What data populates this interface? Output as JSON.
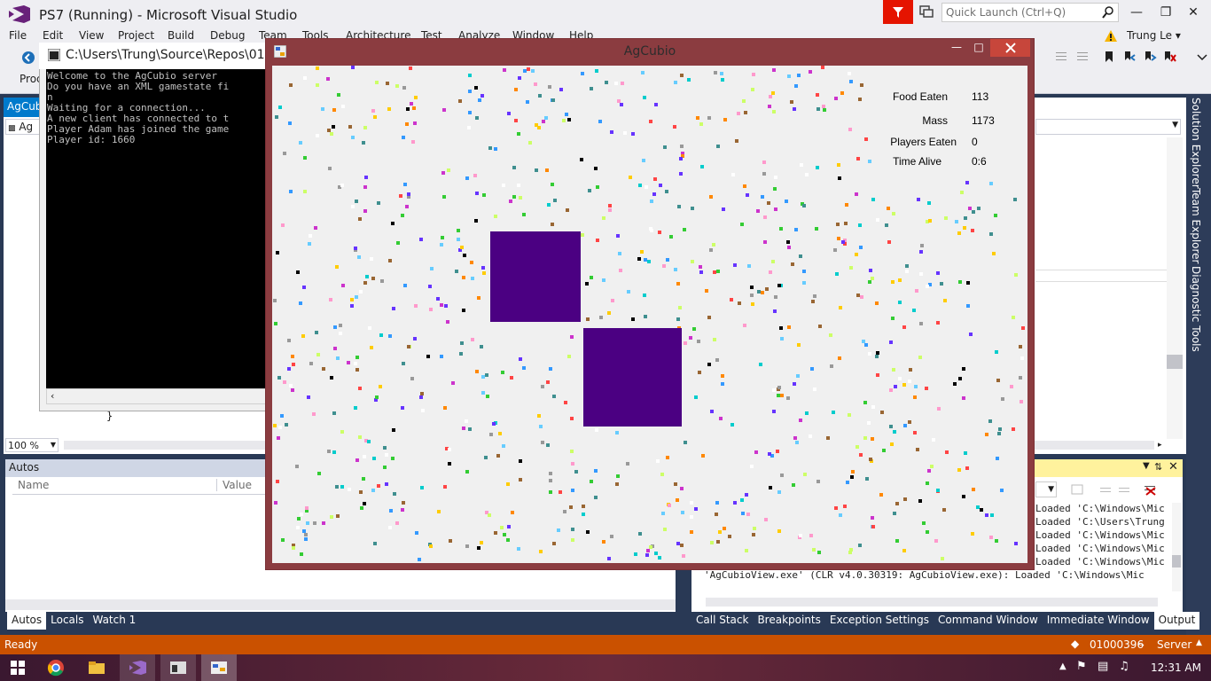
{
  "vs": {
    "title": "PS7 (Running) - Microsoft Visual Studio",
    "quick_launch_placeholder": "Quick Launch (Ctrl+Q)",
    "user": "Trung Le",
    "menu": [
      "File",
      "Edit",
      "View",
      "Project",
      "Build",
      "Debug",
      "Team",
      "Tools",
      "Architecture",
      "Test",
      "Analyze",
      "Window",
      "Help"
    ],
    "editor_tab": "AgCubi",
    "editor_combo": "Ag",
    "code_brace": "}",
    "zoom": "100 %",
    "toolbar_proc": "Proc",
    "side_tabs": [
      "Solution Explorer",
      "Team Explorer",
      "Diagnostic Tools"
    ]
  },
  "autos": {
    "title": "Autos",
    "columns": [
      "Name",
      "Value"
    ],
    "tabs": [
      "Autos",
      "Locals",
      "Watch 1"
    ]
  },
  "output": {
    "lines": [
      "Loaded 'C:\\Windows\\Mic",
      "Loaded 'C:\\Users\\Trung",
      "Loaded 'C:\\Windows\\Mic",
      "Loaded 'C:\\Windows\\Mic",
      "Loaded 'C:\\Windows\\Mic",
      "'AgCubioView.exe' (CLR v4.0.30319: AgCubioView.exe): Loaded 'C:\\Windows\\Mic"
    ],
    "tabs": [
      "Call Stack",
      "Breakpoints",
      "Exception Settings",
      "Command Window",
      "Immediate Window",
      "Output"
    ]
  },
  "status": {
    "text": "Ready",
    "branch_id": "01000396",
    "branch": "Server"
  },
  "taskbar": {
    "time": "12:31 AM"
  },
  "console": {
    "title": "C:\\Users\\Trung\\Source\\Repos\\010",
    "text": "Welcome to the AgCubio server\nDo you have an XML gamestate fi\nn\nWaiting for a connection...\nA new client has connected to t\nPlayer Adam has joined the game\nPlayer id: 1660"
  },
  "agcubio": {
    "title": "AgCubio",
    "stats": [
      {
        "label": "Food Eaten",
        "value": "113"
      },
      {
        "label": "Mass",
        "value": "1173"
      },
      {
        "label": "Players Eaten",
        "value": "0"
      },
      {
        "label": "Time Alive",
        "value": "0:6"
      }
    ],
    "player_color": "#4b0082",
    "food_colors": [
      "#ff4444",
      "#33cc33",
      "#3399ff",
      "#ffcc00",
      "#cc33cc",
      "#00cccc",
      "#000000",
      "#999999",
      "#ff8800",
      "#66ccff",
      "#ff99cc",
      "#996633",
      "#ccff66",
      "#ffffff",
      "#6633ff",
      "#3f8f8f"
    ]
  }
}
